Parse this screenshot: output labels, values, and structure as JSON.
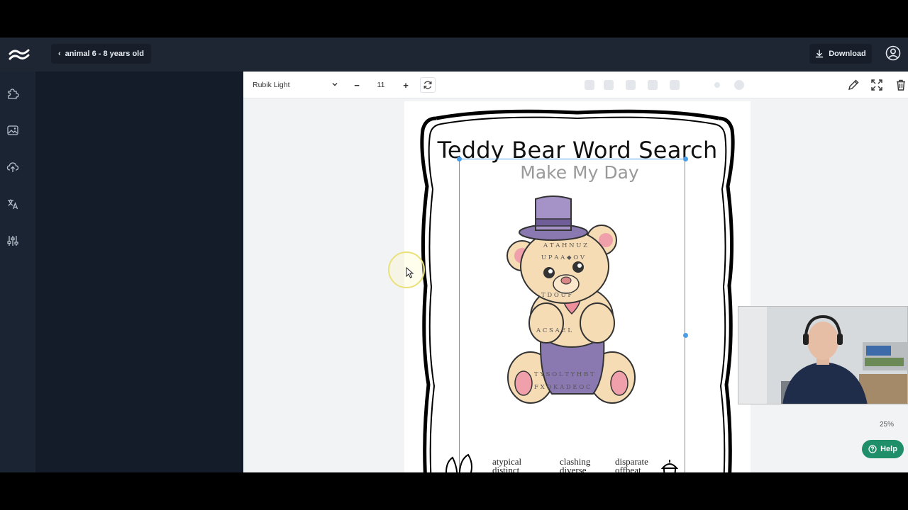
{
  "header": {
    "breadcrumb_label": "animal 6 - 8 years old",
    "download_label": "Download"
  },
  "rail": {
    "icons": [
      "puzzle-icon",
      "image-icon",
      "upload-cloud-icon",
      "translate-icon",
      "sliders-icon"
    ]
  },
  "toolbar": {
    "font_family": "Rubik Light",
    "font_size": "11",
    "minus_label": "−",
    "plus_label": "+"
  },
  "page": {
    "title": "Teddy Bear Word Search",
    "subtitle": "Make My Day",
    "words_col1": "atypical",
    "words_col1b": "distinct",
    "words_col2": "clashing",
    "words_col2b": "diverse",
    "words_col3": "disparate",
    "words_col3b": "offbeat"
  },
  "status": {
    "zoom": "25%",
    "help_label": "Help"
  },
  "colors": {
    "accent": "#4a9ee8",
    "help_green": "#1f8f6a",
    "header_bg": "#1e2633",
    "side_bg": "#141c2a"
  }
}
